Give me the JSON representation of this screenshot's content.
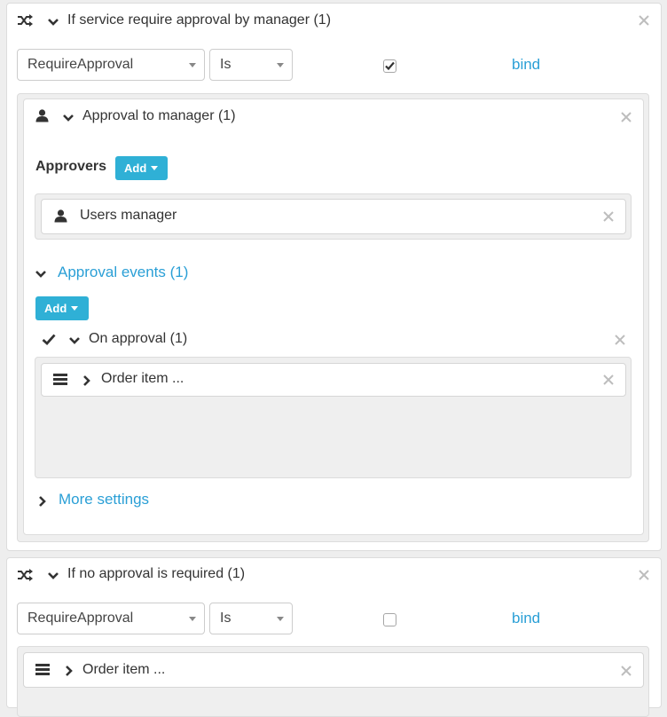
{
  "colors": {
    "link": "#2a9fd6",
    "button": "#2fb0d6",
    "icon": "#333333",
    "close": "#bdbdbd"
  },
  "condition1": {
    "title": "If service require approval by manager (1)",
    "field_value": "RequireApproval",
    "operator_value": "Is",
    "checked": true,
    "bind_label": "bind",
    "icons": [
      "shuffle-icon",
      "chevron-down-icon",
      "close-icon"
    ]
  },
  "approval": {
    "title": "Approval to manager (1)",
    "approvers_label": "Approvers",
    "add_label": "Add",
    "approver": "Users manager",
    "events_title": "Approval events (1)",
    "events_add_label": "Add",
    "on_approval_title": "On approval (1)",
    "order_item_label": "Order item ...",
    "more_settings_label": "More settings",
    "icons": [
      "user-icon",
      "chevron-down-icon",
      "close-icon",
      "check-icon",
      "list-icon",
      "chevron-right-icon"
    ]
  },
  "condition2": {
    "title": "If no approval is required (1)",
    "field_value": "RequireApproval",
    "operator_value": "Is",
    "checked": false,
    "bind_label": "bind",
    "order_item_label": "Order item ..."
  }
}
